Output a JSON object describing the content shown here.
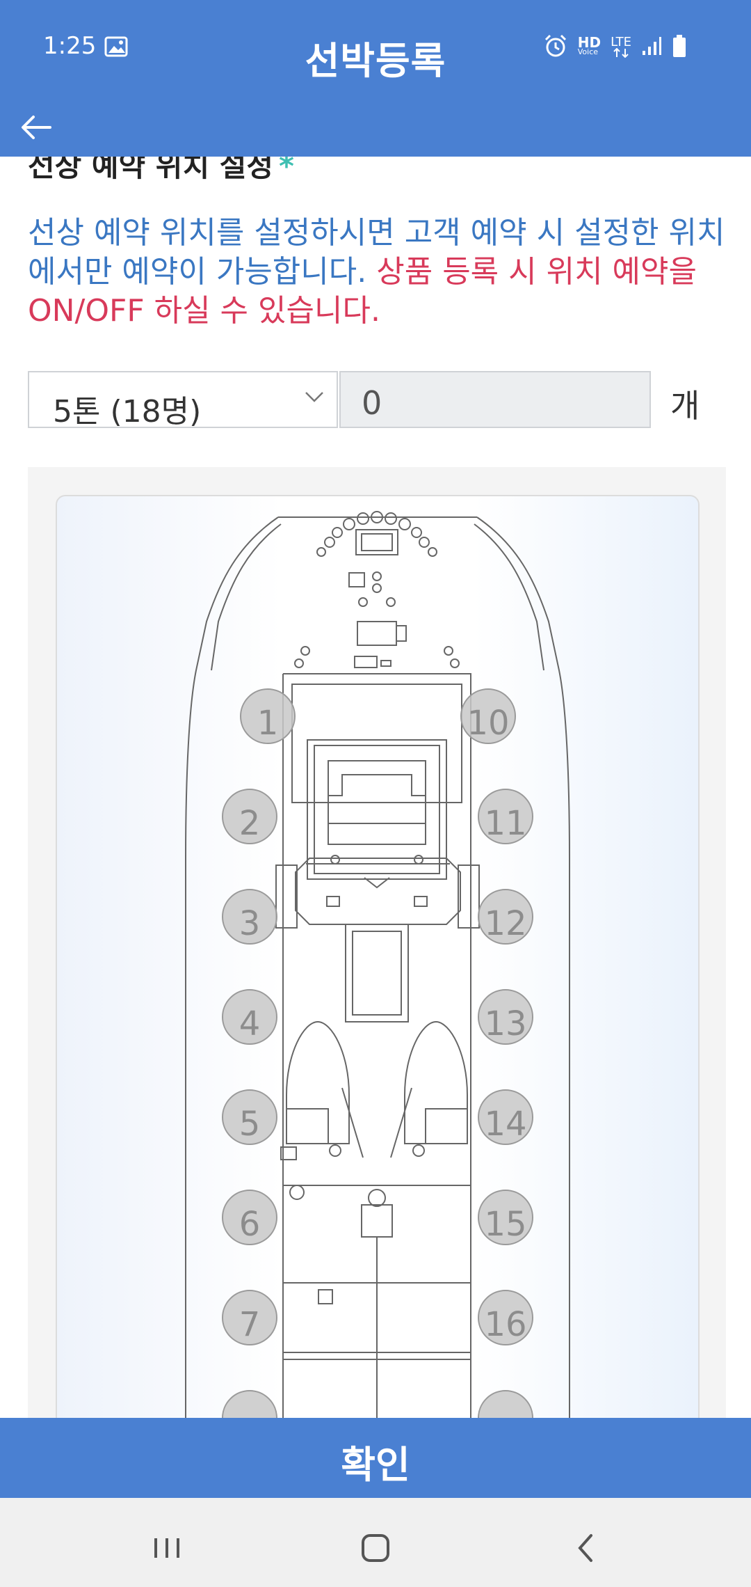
{
  "status_bar": {
    "time": "1:25",
    "icons": [
      "photo-icon",
      "alarm-icon",
      "hd-voice-icon",
      "lte-icon",
      "signal-icon",
      "battery-icon"
    ],
    "hd_label": "HD",
    "voice_label": "Voice",
    "lte_label": "LTE"
  },
  "header": {
    "title": "선박등록",
    "back_icon": "arrow-left-icon"
  },
  "section": {
    "title": "선상 예약 위치 설정",
    "required_mark": "*",
    "description_blue": "선상 예약 위치를 설정하시면 고객 예약 시 설정한 위치에서만 예약이 가능합니다.",
    "description_red": "상품 등록 시 위치 예약을 ON/OFF 하실 수 있습니다."
  },
  "form": {
    "boat_size_selected": "5톤 (18명)",
    "count_value": "0",
    "unit": "개"
  },
  "seats": {
    "left": [
      "1",
      "2",
      "3",
      "4",
      "5",
      "6",
      "7",
      ""
    ],
    "right": [
      "10",
      "11",
      "12",
      "13",
      "14",
      "15",
      "16",
      ""
    ]
  },
  "confirm_button": "확인",
  "nav": {
    "icons": [
      "recent-apps-icon",
      "home-icon",
      "back-icon"
    ]
  },
  "colors": {
    "primary": "#4a80d2",
    "description_blue": "#3a77c2",
    "description_red": "#d83a5a",
    "required": "#3fbfb2"
  }
}
